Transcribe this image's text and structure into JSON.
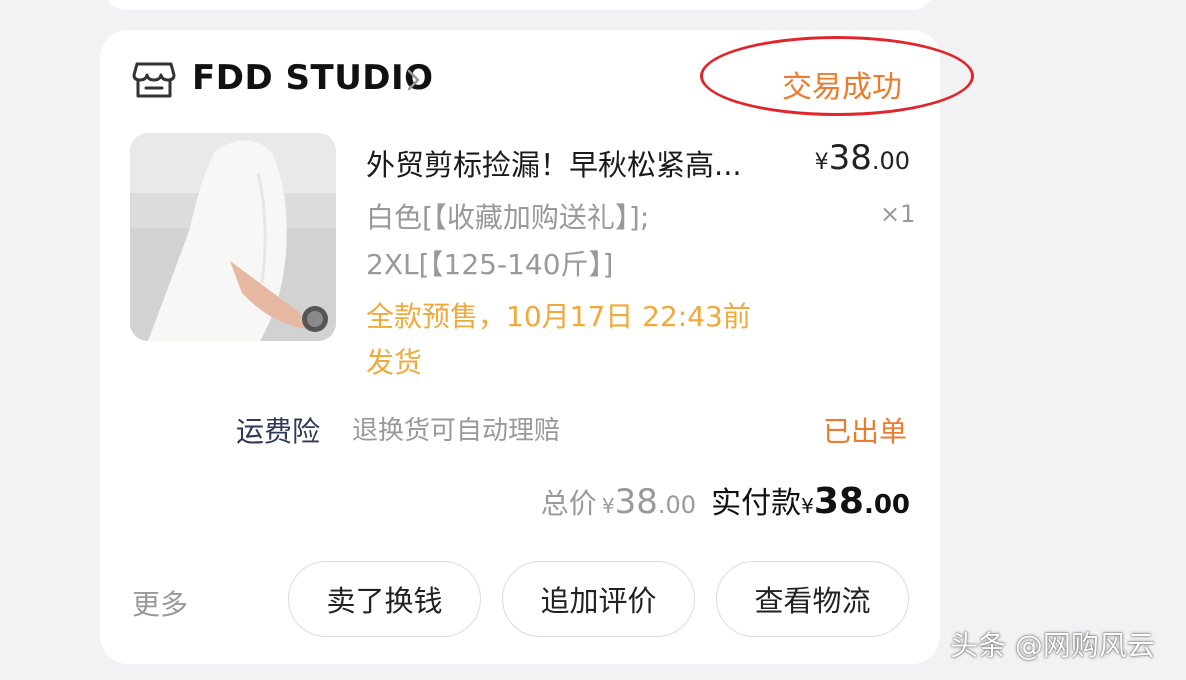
{
  "order": {
    "shop_name": "FDD STUDIO",
    "status": "交易成功",
    "product": {
      "title": "外贸剪标捡漏！早秋松紧高...",
      "price_yen": "¥",
      "price_int": "38",
      "price_dec": ".00",
      "quantity": "×1",
      "sku_line1": "白色[【收藏加购送礼】];",
      "sku_line2": "2XL[【125-140斤】]",
      "presale_line1": "全款预售，10月17日 22:43前",
      "presale_line2": "发货"
    },
    "insurance": {
      "label": "运费险",
      "description": "退换货可自动理赔",
      "status": "已出单"
    },
    "totals": {
      "total_label": "总价",
      "total_yen": "¥",
      "total_int": "38",
      "total_dec": ".00",
      "paid_label": "实付款",
      "paid_yen": "¥",
      "paid_int": "38",
      "paid_dec": ".00"
    },
    "actions": {
      "more": "更多",
      "sell": "卖了换钱",
      "review": "追加评价",
      "logistics": "查看物流"
    }
  },
  "watermark": "头条 @网购风云",
  "colors": {
    "status_orange": "#ee7b2b",
    "presale_orange": "#f0a93b",
    "annotation_red": "#e0262b",
    "insurance_navy": "#2e3957"
  },
  "icons": {
    "shop": "store-icon",
    "shop_arrow": "chevron-right-icon"
  }
}
